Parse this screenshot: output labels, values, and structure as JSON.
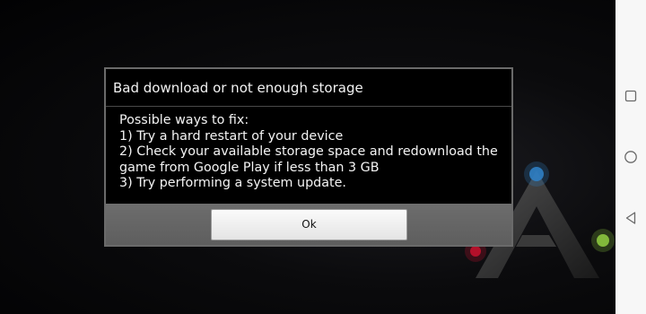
{
  "dialog": {
    "title": "Bad download or not enough storage",
    "message_lines": [
      "Possible ways to fix:",
      "1) Try a hard restart of your device",
      "2) Check your available storage space and redownload the",
      "game from Google Play if less than 3 GB",
      "3) Try performing a system update."
    ],
    "ok_label": "Ok"
  },
  "navigation_bar": {
    "buttons": [
      {
        "name": "recents",
        "icon": "square-icon"
      },
      {
        "name": "home",
        "icon": "circle-icon"
      },
      {
        "name": "back",
        "icon": "triangle-back-icon"
      }
    ]
  },
  "background": {
    "logo": "ark-logo",
    "colors": {
      "logo_blue": "#2f7fc4",
      "logo_green": "#8cc63f",
      "logo_red": "#c8102e"
    }
  }
}
